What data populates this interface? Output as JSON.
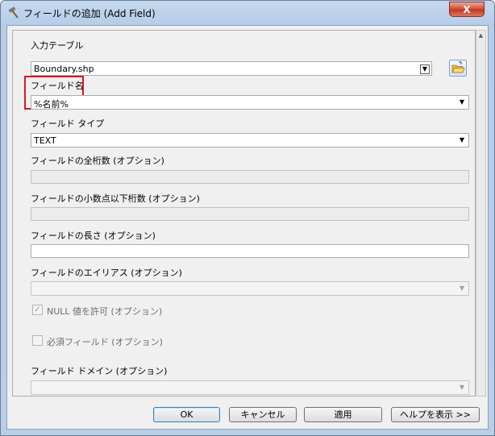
{
  "window": {
    "title": "フィールドの追加 (Add Field)",
    "close_label": "X"
  },
  "fields": {
    "input_table": {
      "label": "入力テーブル",
      "value": "Boundary.shp"
    },
    "field_name": {
      "label": "フィールド名",
      "value": "%名前%"
    },
    "field_type": {
      "label": "フィールド タイプ",
      "value": "TEXT"
    },
    "precision": {
      "label": "フィールドの全桁数 (オプション)",
      "value": ""
    },
    "scale": {
      "label": "フィールドの小数点以下桁数 (オプション)",
      "value": ""
    },
    "length": {
      "label": "フィールドの長さ (オプション)",
      "value": ""
    },
    "alias": {
      "label": "フィールドのエイリアス (オプション)",
      "value": ""
    },
    "nullable": {
      "label": "NULL 値を許可 (オプション)",
      "checked": true
    },
    "required": {
      "label": "必須フィールド (オプション)",
      "checked": false
    },
    "domain": {
      "label": "フィールド ドメイン (オプション)",
      "value": ""
    }
  },
  "buttons": {
    "ok": "OK",
    "cancel": "キャンセル",
    "apply": "適用",
    "help": "ヘルプを表示 >>"
  },
  "icons": {
    "title_icon": "hammer-icon",
    "browse_icon": "open-folder-icon",
    "dropdown_icon": "chevron-down-icon"
  },
  "colors": {
    "highlight": "#e0161f",
    "title_bar": "#c5d8ee",
    "close_button": "#c1341d"
  }
}
